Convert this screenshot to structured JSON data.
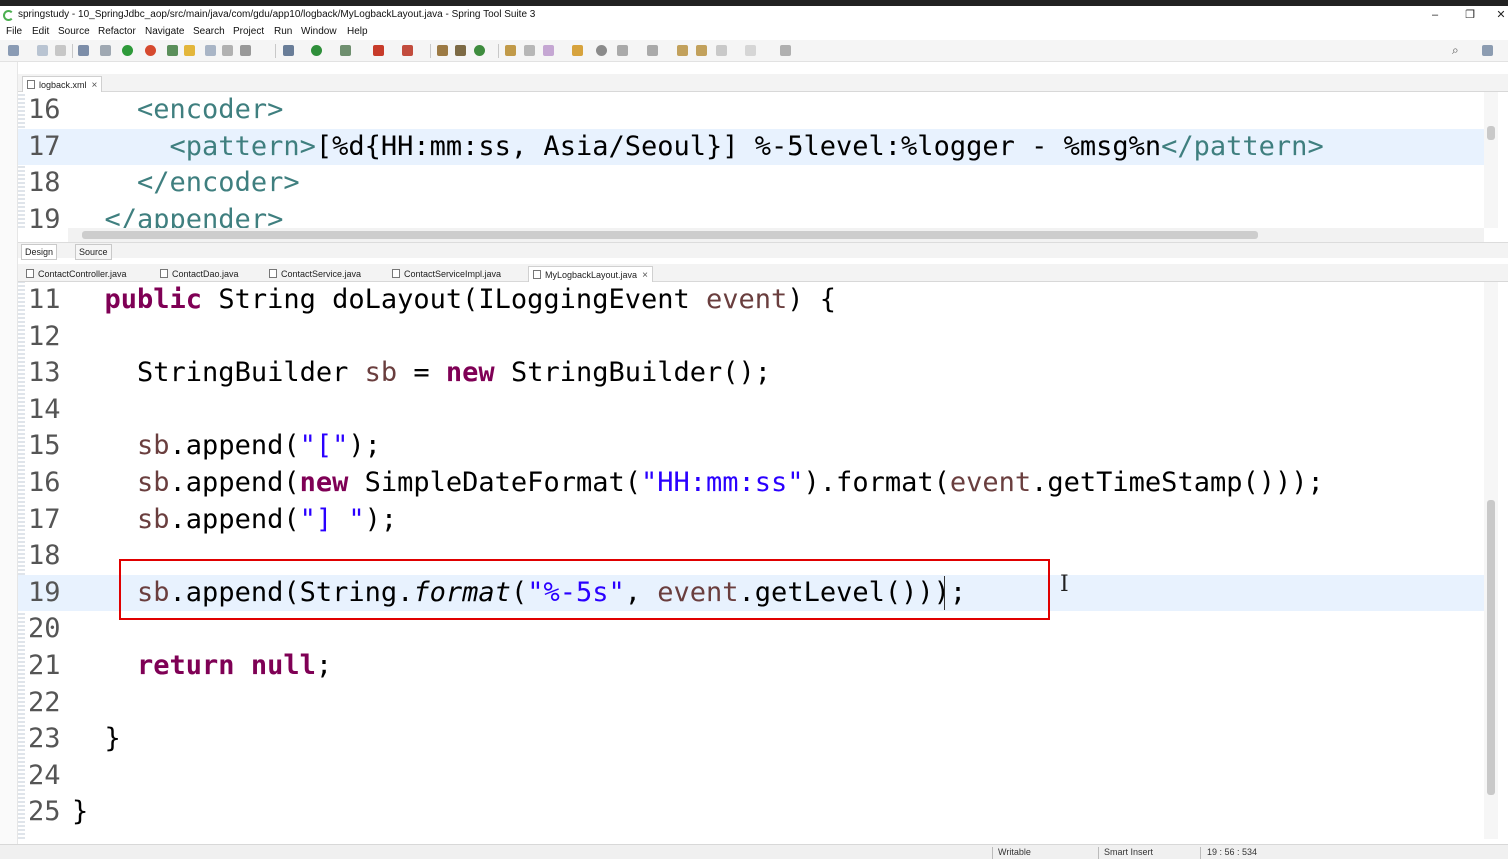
{
  "window": {
    "title": "springstudy - 10_SpringJdbc_aop/src/main/java/com/gdu/app10/logback/MyLogbackLayout.java - Spring Tool Suite 3",
    "minimize": "–",
    "maximize": "❐",
    "close": "✕"
  },
  "menu": [
    "File",
    "Edit",
    "Source",
    "Refactor",
    "Navigate",
    "Search",
    "Project",
    "Run",
    "Window",
    "Help"
  ],
  "xml_editor": {
    "tab_label": "logback.xml",
    "lines": [
      {
        "num": "16",
        "indent": "    ",
        "parts": [
          {
            "t": "<encoder>",
            "c": "tag"
          }
        ]
      },
      {
        "num": "17",
        "indent": "      ",
        "parts": [
          {
            "t": "<pattern>",
            "c": "tag"
          },
          {
            "t": "[%d{HH:mm:ss, Asia/Seoul}] %-5level:%logger - %msg%n",
            "c": ""
          },
          {
            "t": "</pattern>",
            "c": "tag"
          }
        ]
      },
      {
        "num": "18",
        "indent": "    ",
        "parts": [
          {
            "t": "</encoder>",
            "c": "tag"
          }
        ]
      },
      {
        "num": "19",
        "indent": "  ",
        "parts": [
          {
            "t": "</appender>",
            "c": "tag"
          }
        ]
      }
    ],
    "design_tab": "Design",
    "source_tab": "Source"
  },
  "java_tabs": [
    "ContactController.java",
    "ContactDao.java",
    "ContactService.java",
    "ContactServiceImpl.java",
    "MyLogbackLayout.java"
  ],
  "java_editor": {
    "lines": [
      {
        "num": "11",
        "indent": "  ",
        "parts": [
          {
            "t": "public",
            "c": "kw"
          },
          {
            "t": " String doLayout(ILoggingEvent ",
            "c": ""
          },
          {
            "t": "event",
            "c": "var"
          },
          {
            "t": ") {",
            "c": ""
          }
        ]
      },
      {
        "num": "12",
        "indent": "",
        "parts": []
      },
      {
        "num": "13",
        "indent": "    ",
        "parts": [
          {
            "t": "StringBuilder ",
            "c": ""
          },
          {
            "t": "sb",
            "c": "var"
          },
          {
            "t": " = ",
            "c": ""
          },
          {
            "t": "new",
            "c": "kw"
          },
          {
            "t": " StringBuilder();",
            "c": ""
          }
        ]
      },
      {
        "num": "14",
        "indent": "",
        "parts": []
      },
      {
        "num": "15",
        "indent": "    ",
        "parts": [
          {
            "t": "sb",
            "c": "var"
          },
          {
            "t": ".append(",
            "c": ""
          },
          {
            "t": "\"[\"",
            "c": "str"
          },
          {
            "t": ");",
            "c": ""
          }
        ]
      },
      {
        "num": "16",
        "indent": "    ",
        "parts": [
          {
            "t": "sb",
            "c": "var"
          },
          {
            "t": ".append(",
            "c": ""
          },
          {
            "t": "new",
            "c": "kw"
          },
          {
            "t": " SimpleDateFormat(",
            "c": ""
          },
          {
            "t": "\"HH:mm:ss\"",
            "c": "str"
          },
          {
            "t": ").format(",
            "c": ""
          },
          {
            "t": "event",
            "c": "var"
          },
          {
            "t": ".getTimeStamp()));",
            "c": ""
          }
        ]
      },
      {
        "num": "17",
        "indent": "    ",
        "parts": [
          {
            "t": "sb",
            "c": "var"
          },
          {
            "t": ".append(",
            "c": ""
          },
          {
            "t": "\"] \"",
            "c": "str"
          },
          {
            "t": ");",
            "c": ""
          }
        ]
      },
      {
        "num": "18",
        "indent": "",
        "parts": []
      },
      {
        "num": "19",
        "indent": "    ",
        "parts": [
          {
            "t": "sb",
            "c": "var"
          },
          {
            "t": ".append(String.",
            "c": ""
          },
          {
            "t": "format",
            "c": "it"
          },
          {
            "t": "(",
            "c": ""
          },
          {
            "t": "\"%-5s\"",
            "c": "str"
          },
          {
            "t": ", ",
            "c": ""
          },
          {
            "t": "event",
            "c": "var"
          },
          {
            "t": ".getLevel()));",
            "c": ""
          }
        ]
      },
      {
        "num": "20",
        "indent": "",
        "parts": []
      },
      {
        "num": "21",
        "indent": "    ",
        "parts": [
          {
            "t": "return",
            "c": "kw"
          },
          {
            "t": " ",
            "c": ""
          },
          {
            "t": "null",
            "c": "kw"
          },
          {
            "t": ";",
            "c": ""
          }
        ]
      },
      {
        "num": "22",
        "indent": "",
        "parts": []
      },
      {
        "num": "23",
        "indent": "  ",
        "parts": [
          {
            "t": "}",
            "c": ""
          }
        ]
      },
      {
        "num": "24",
        "indent": "",
        "parts": []
      },
      {
        "num": "25",
        "indent": "",
        "parts": [
          {
            "t": "}",
            "c": ""
          }
        ]
      }
    ]
  },
  "status": {
    "writable": "Writable",
    "insert_mode": "Smart Insert",
    "position": "19 : 56 : 534"
  },
  "colors": {
    "keyword": "#7f0055",
    "string": "#2a00ff",
    "xml_tag": "#3f7f7f",
    "variable": "#6a3e3e",
    "current_line": "#e8f2fe",
    "highlight_box": "#e00000"
  }
}
